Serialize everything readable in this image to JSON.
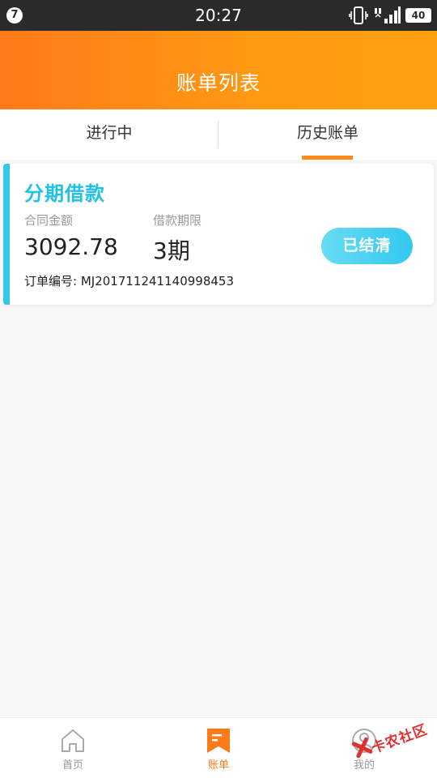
{
  "status_bar": {
    "notification_count": "7",
    "time": "20:27",
    "battery": "40"
  },
  "header": {
    "title": "账单列表"
  },
  "tabs": {
    "active": "历史账单",
    "items": [
      {
        "label": "进行中"
      },
      {
        "label": "历史账单"
      }
    ]
  },
  "bill_card": {
    "title": "分期借款",
    "contract_amount_label": "合同金额",
    "contract_amount_value": "3092.78",
    "term_label": "借款期限",
    "term_value": "3期",
    "order_label": "订单编号:",
    "order_number": "MJ201711241140998453",
    "status_label": "已结清"
  },
  "bottom_nav": {
    "active": "账单",
    "items": [
      {
        "label": "首页",
        "icon": "home-icon"
      },
      {
        "label": "账单",
        "icon": "bill-icon"
      },
      {
        "label": "我的",
        "icon": "profile-icon"
      }
    ]
  },
  "watermark": {
    "text": "卡农社区"
  },
  "colors": {
    "header_gradient_start": "#ff7a1a",
    "header_gradient_end": "#ffa00f",
    "accent_cyan": "#1fc1e6",
    "active_orange": "#ff7a1a"
  }
}
